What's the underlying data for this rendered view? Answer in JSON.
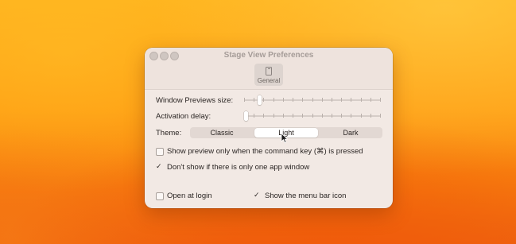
{
  "window": {
    "title": "Stage View Preferences",
    "toolbar_tab": {
      "label": "General",
      "icon": "phone-icon"
    }
  },
  "settings": {
    "window_previews_size": {
      "label": "Window Previews size:",
      "value_fraction": 0.1
    },
    "activation_delay": {
      "label": "Activation delay:",
      "value_fraction": 0.0
    },
    "theme": {
      "label": "Theme:",
      "options": [
        "Classic",
        "Light",
        "Dark"
      ],
      "selected": "Light"
    },
    "checkboxes": [
      {
        "label": "Show preview only when the command key (⌘) is pressed",
        "checked": false
      },
      {
        "label": "Don't show if there is only one app window",
        "checked": true
      },
      {
        "label": "Open at login",
        "checked": false
      },
      {
        "label": "Show the menu bar icon",
        "checked": true
      }
    ]
  },
  "check_glyph": "✓",
  "colors": {
    "window_bg": "#f2e9e4",
    "selected_segment": "#ffffff",
    "desktop_orange": "#ff9d12"
  }
}
